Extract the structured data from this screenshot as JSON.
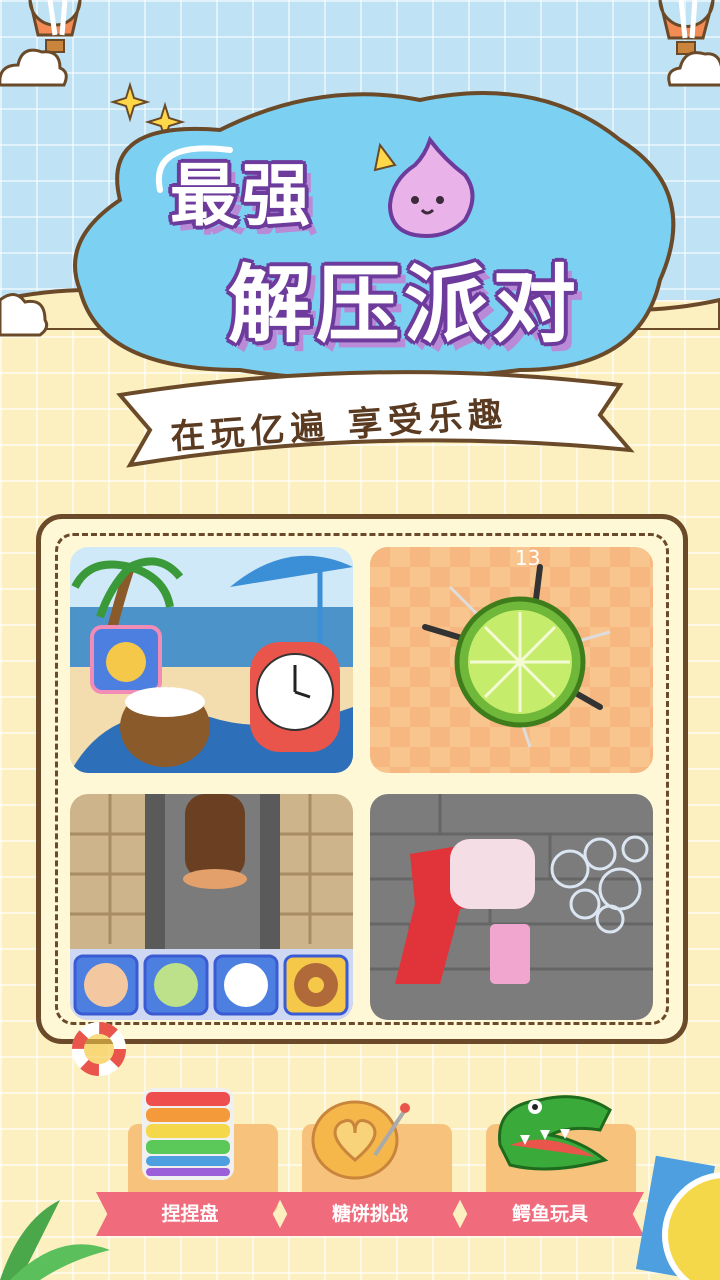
{
  "hero": {
    "title_line1": "最强",
    "title_line2": "解压派对",
    "banner_text": "在玩亿遍 享受乐趣"
  },
  "games": {
    "knife_game": {
      "counter": "13"
    }
  },
  "bottom_items": [
    {
      "label": "捏捏盘"
    },
    {
      "label": "糖饼挑战"
    },
    {
      "label": "鳄鱼玩具"
    }
  ],
  "colors": {
    "sky": "#bfe3f5",
    "ground": "#fdf0c0",
    "title_outline": "#6d3b9c",
    "ribbon": "#f06c7c",
    "card": "#f7c37c",
    "panel_border": "#6a4a28"
  }
}
